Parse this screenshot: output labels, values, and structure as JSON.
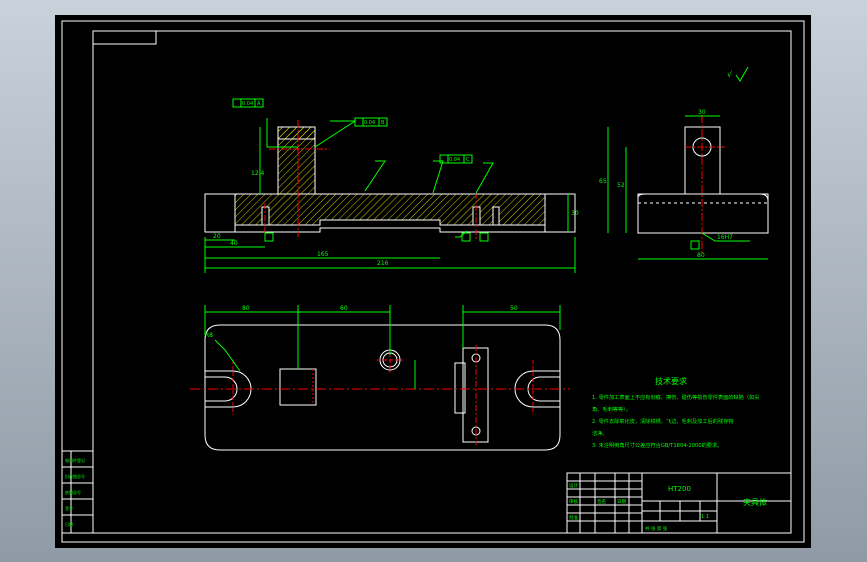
{
  "colors": {
    "background": "#000000",
    "frame": "#ffffff",
    "part": "#ffffff",
    "dimension": "#00ff00",
    "centerline": "#ff0000",
    "hatch": "#ffff00"
  },
  "symbols": {
    "roughness_general": "√"
  },
  "front_view": {
    "dims": {
      "total_length": "216",
      "inner_length": "165",
      "left_offset": "40",
      "left_small": "20",
      "height": "30",
      "boss": "12.4"
    },
    "tolerance_flags": [
      "0.04",
      "0.04",
      "0.04"
    ],
    "datum_labels": [
      "A",
      "B",
      "C"
    ]
  },
  "side_view": {
    "dims": {
      "width_top": "30",
      "height_total": "65",
      "height_mid": "52",
      "bore": "16H7",
      "bottom": "80"
    }
  },
  "top_view": {
    "dims": {
      "a": "80",
      "b": "60",
      "c": "50",
      "slot": "R8"
    }
  },
  "tech_requirements": {
    "title": "技术要求",
    "lines": [
      "1. 零件加工表面上不应有划痕、擦伤、碰伤等损伤零件表面的缺陷（如尖",
      "   角、毛刺等等）。",
      "2. 零件去除氧化皮，清除铁锈、飞边、毛刺及加工后的残存物",
      "   洁净。",
      "3. 未注明倒角尺寸公差应符合GB/T1804-2000的要求。"
    ]
  },
  "title_block": {
    "material": "HT200",
    "part_name": "夹具体",
    "scale": "1:1",
    "sheet": "共  张  第  张",
    "designer_label": "设计",
    "checker_label": "审核",
    "approve_label": "批准",
    "sign_label": "签名",
    "date_label": "日期"
  },
  "side_table": {
    "rows": [
      "借用件登记",
      "旧底图总号",
      "底图总号",
      "签字",
      "日期"
    ]
  }
}
